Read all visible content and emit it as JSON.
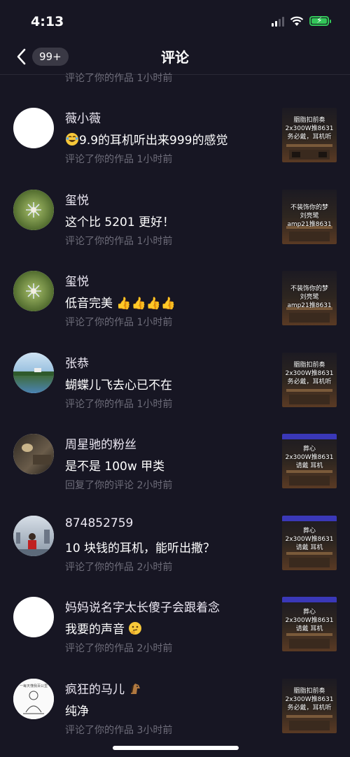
{
  "status": {
    "time": "4:13"
  },
  "nav": {
    "title": "评论",
    "badge": "99+"
  },
  "partial_meta": "评论了你的作品  1小时前",
  "items": [
    {
      "name": "薇小薇",
      "comment": "9.9的耳机听出来999的感觉",
      "emoji_before": "cry-laugh-emoji",
      "meta": "评论了你的作品  1小时前",
      "thumb": [
        "胭脂扣前奏",
        "2x300W推8631",
        "务必戴，耳机听"
      ],
      "avatar": "blank"
    },
    {
      "name": "玺悦",
      "comment": "这个比 5201 更好！",
      "meta": "评论了你的作品  1小时前",
      "thumb": [
        "不装饰你的梦",
        "刘亮鹭",
        "amp21推8631"
      ],
      "avatar": "flower"
    },
    {
      "name": "玺悦",
      "comment": "低音完美",
      "emoji_after": "thumbs-up-emoji x4",
      "meta": "评论了你的作品  1小时前",
      "thumb": [
        "不装饰你的梦",
        "刘亮鹭",
        "amp21推8631"
      ],
      "avatar": "flower"
    },
    {
      "name": "张恭",
      "comment": "蝴蝶儿飞去心已不在",
      "meta": "评论了你的作品  1小时前",
      "thumb": [
        "胭脂扣前奏",
        "2x300W推8631",
        "务必戴，耳机听"
      ],
      "avatar": "lake"
    },
    {
      "name": "周星驰的粉丝",
      "comment": "是不是 100w 甲类",
      "meta": "回复了你的评论  2小时前",
      "thumb": [
        "葬心",
        "2x300W推8631",
        "请戴  耳机"
      ],
      "avatar": "room"
    },
    {
      "name": "874852759",
      "comment": "10 块钱的耳机，能听出撒？",
      "meta": "评论了你的作品  2小时前",
      "thumb": [
        "葬心",
        "2x300W推8631",
        "请戴  耳机"
      ],
      "avatar": "city"
    },
    {
      "name": "妈妈说名字太长傻子会跟着念",
      "comment": "我要的声音",
      "emoji_after": "thinking-emoji",
      "meta": "评论了你的作品  2小时前",
      "thumb": [
        "葬心",
        "2x300W推8631",
        "请戴  耳机"
      ],
      "avatar": "blank"
    },
    {
      "name": "疯狂的马儿",
      "name_emoji": "horse-emoji",
      "comment": "纯净",
      "meta": "评论了你的作品  3小时前",
      "thumb": [
        "胭脂扣前奏",
        "2x300W推8631",
        "务必戴，耳机听"
      ],
      "avatar": "sketch",
      "avatar_text": "一每天懂我百公里"
    }
  ],
  "colors": {
    "background": "#171623",
    "meta_text": "#6e6d7a",
    "battery": "#33c759"
  }
}
